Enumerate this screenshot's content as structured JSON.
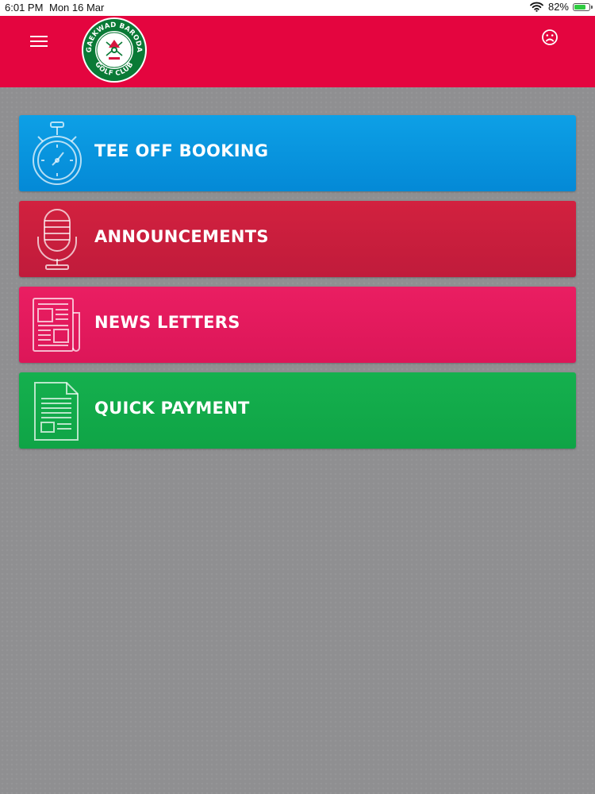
{
  "status_bar": {
    "time": "6:01 PM",
    "date": "Mon 16 Mar",
    "battery_percent": "82%",
    "battery_level": 0.82
  },
  "header": {
    "logo_text_top": "GAEKWAD BARODA",
    "logo_text_bottom": "GOLF CLUB",
    "background_color": "#e4053f"
  },
  "menu": {
    "items": [
      {
        "label": "TEE OFF BOOKING",
        "icon": "stopwatch-icon",
        "color": "#0a95de"
      },
      {
        "label": "ANNOUNCEMENTS",
        "icon": "microphone-icon",
        "color": "#c91e3d"
      },
      {
        "label": "NEWS LETTERS",
        "icon": "newspaper-icon",
        "color": "#e31a5d"
      },
      {
        "label": "QUICK PAYMENT",
        "icon": "document-icon",
        "color": "#12aa4a"
      }
    ]
  }
}
